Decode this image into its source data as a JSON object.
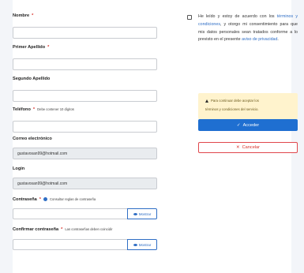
{
  "form": {
    "nombre": {
      "label": "Nombre",
      "required": "*",
      "value": ""
    },
    "primer_apellido": {
      "label": "Primer Apellido",
      "required": "*",
      "value": ""
    },
    "segundo_apellido": {
      "label": "Segundo Apellido",
      "value": ""
    },
    "telefono": {
      "label": "Teléfono",
      "required": "*",
      "hint": "Debe contener 10 dígitos",
      "value": ""
    },
    "correo": {
      "label": "Correo electrónico",
      "value": "gustavosan99@hotmail.com"
    },
    "login": {
      "label": "Login",
      "value": "gustavosan99@hotmail.com"
    },
    "contrasena": {
      "label": "Contraseña",
      "required": "*",
      "hint": "Consultar reglas de contraseña",
      "button": "Mostrar",
      "value": ""
    },
    "confirmar": {
      "label": "Confirmar contraseña",
      "required": "*",
      "hint": "Las contraseñas deben coincidir",
      "button": "Mostrar",
      "value": ""
    }
  },
  "terms": {
    "text_before": "He leído y estoy de acuerdo con los ",
    "link_terms": "términos y condiciones",
    "text_middle": ", y otorgo mi consentimiento para que mis datos personales sean tratados conforme a lo previsto en el presente ",
    "link_privacy": "aviso de privacidad",
    "text_after": ".",
    "checked": false
  },
  "warning": {
    "line1": "Para continuar debe aceptar los",
    "line2": "términos y condiciones del servicio."
  },
  "buttons": {
    "acceder": "Acceder",
    "cancelar": "Cancelar",
    "acceder_icon": "check-icon",
    "cancelar_icon": "x-icon"
  },
  "colors": {
    "primary": "#1f6fd1",
    "danger": "#d9312b",
    "warning_bg": "#fff3cd"
  }
}
